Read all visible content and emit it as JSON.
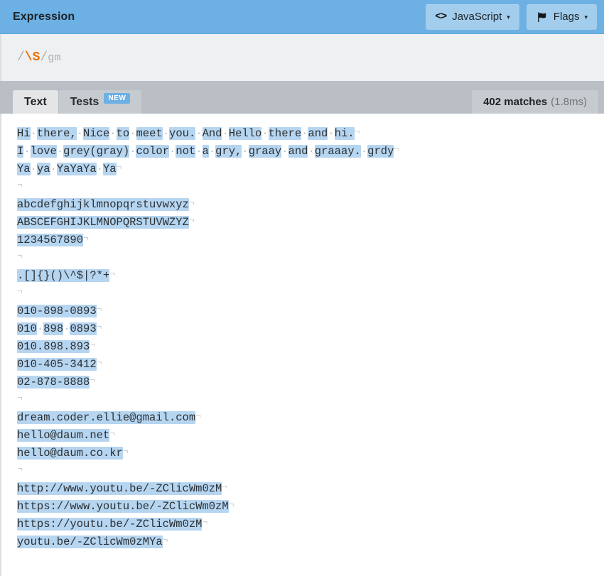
{
  "header": {
    "title": "Expression",
    "buttons": [
      {
        "icon": "code-icon",
        "icon_glyph": "<>",
        "label": "JavaScript",
        "caret": "▾"
      },
      {
        "icon": "flag-icon",
        "label": "Flags",
        "caret": "▾"
      }
    ]
  },
  "expression": {
    "open_delimiter": "/",
    "pattern": "\\S",
    "close_delimiter": "/",
    "flags": "gm"
  },
  "tabs": [
    {
      "label": "Text",
      "active": true,
      "badge": null
    },
    {
      "label": "Tests",
      "active": false,
      "badge": "NEW"
    }
  ],
  "matches": {
    "count_label": "402 matches",
    "time_label": "(1.8ms)"
  },
  "colors": {
    "header_blue": "#6cb0e4",
    "header_button": "#a3cdec",
    "expression_token": "#e8710a",
    "expression_slash": "#a9afb4",
    "tabbar_gray": "#b9bfc4",
    "tab_active": "#e3e5e7",
    "highlight_blue": "#b6d5f0",
    "badge_blue": "#6cb0e4",
    "text_background": "#ffffff",
    "page_background": "#eff0f2"
  },
  "text_content": {
    "raw_lines": [
      "Hi there, Nice to meet you. And Hello there and hi.",
      "I love grey(gray) color not a gry, graay and graaay. grdy",
      "Ya ya YaYaYa Ya",
      "",
      "abcdefghijklmnopqrstuvwxyz",
      "ABSCEFGHIJKLMNOPQRSTUVWZYZ",
      "1234567890",
      "",
      ".[]{}()\\^$|?*+",
      "",
      "010-898-0893",
      "010 898 0893",
      "010.898.893",
      "010-405-3412",
      "02-878-8888",
      "",
      "dream.coder.ellie@gmail.com",
      "hello@daum.net",
      "hello@daum.co.kr",
      "",
      "http://www.youtu.be/-ZClicWm0zM",
      "https://www.youtu.be/-ZClicWm0zM",
      "https://youtu.be/-ZClicWm0zM",
      "youtu.be/-ZClicWm0zMYa"
    ]
  }
}
